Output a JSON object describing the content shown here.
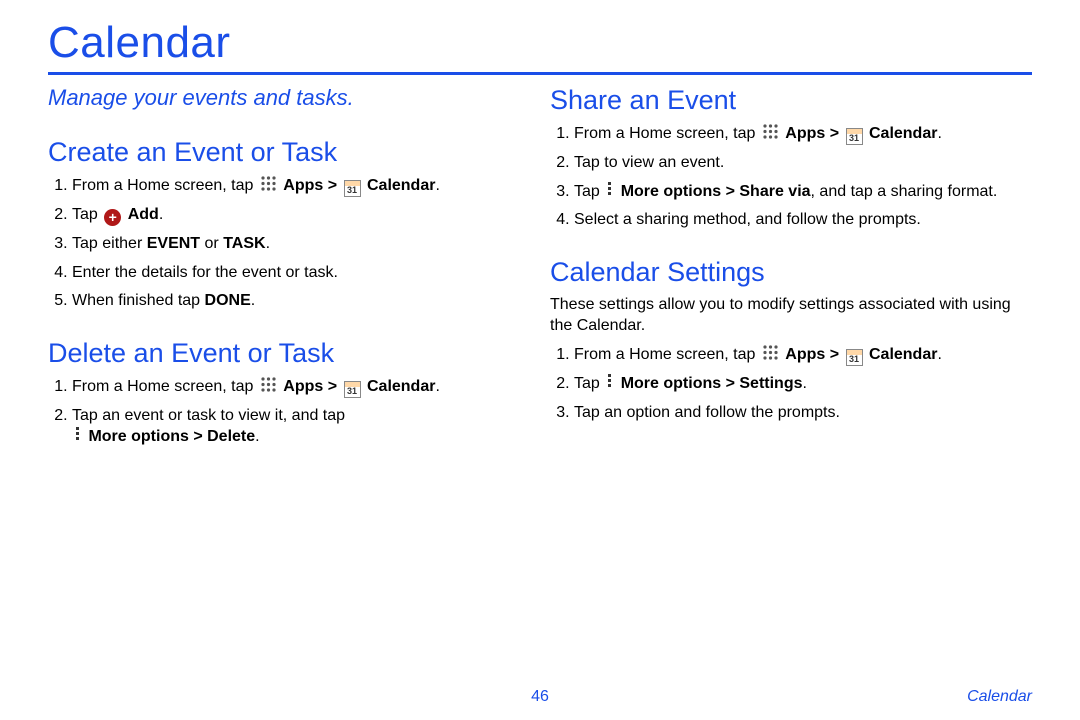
{
  "page": {
    "title": "Calendar",
    "subtitle": "Manage your events and tasks.",
    "number": "46",
    "footer_label": "Calendar"
  },
  "icons": {
    "calendar_day": "31",
    "add_symbol": "+"
  },
  "sections": {
    "create": {
      "heading": "Create an Event or Task",
      "steps": {
        "s1a": "From a Home screen, tap ",
        "s1b": " Apps > ",
        "s1c": " Calendar",
        "s1d": ".",
        "s2a": "Tap ",
        "s2b": " Add",
        "s2c": ".",
        "s3a": "Tap either ",
        "s3b": "EVENT",
        "s3c": " or ",
        "s3d": "TASK",
        "s3e": ".",
        "s4": "Enter the details for the event or task.",
        "s5a": "When finished tap ",
        "s5b": "DONE",
        "s5c": "."
      }
    },
    "delete": {
      "heading": "Delete an Event or Task",
      "steps": {
        "s1a": "From a Home screen, tap ",
        "s1b": " Apps > ",
        "s1c": " Calendar",
        "s1d": ".",
        "s2a": "Tap an event or task to view it, and tap ",
        "s2b": " More options > Delete",
        "s2c": "."
      }
    },
    "share": {
      "heading": "Share an Event",
      "steps": {
        "s1a": "From a Home screen, tap ",
        "s1b": " Apps > ",
        "s1c": " Calendar",
        "s1d": ".",
        "s2": "Tap to view an event.",
        "s3a": "Tap ",
        "s3b": " More options > Share via",
        "s3c": ", and tap a sharing format.",
        "s4": "Select a sharing method, and follow the prompts."
      }
    },
    "settings": {
      "heading": "Calendar Settings",
      "intro": "These settings allow you to modify settings associated with using the Calendar.",
      "steps": {
        "s1a": "From a Home screen, tap ",
        "s1b": " Apps > ",
        "s1c": " Calendar",
        "s1d": ".",
        "s2a": "Tap ",
        "s2b": " More options > Settings",
        "s2c": ".",
        "s3": "Tap an option and follow the prompts."
      }
    }
  }
}
